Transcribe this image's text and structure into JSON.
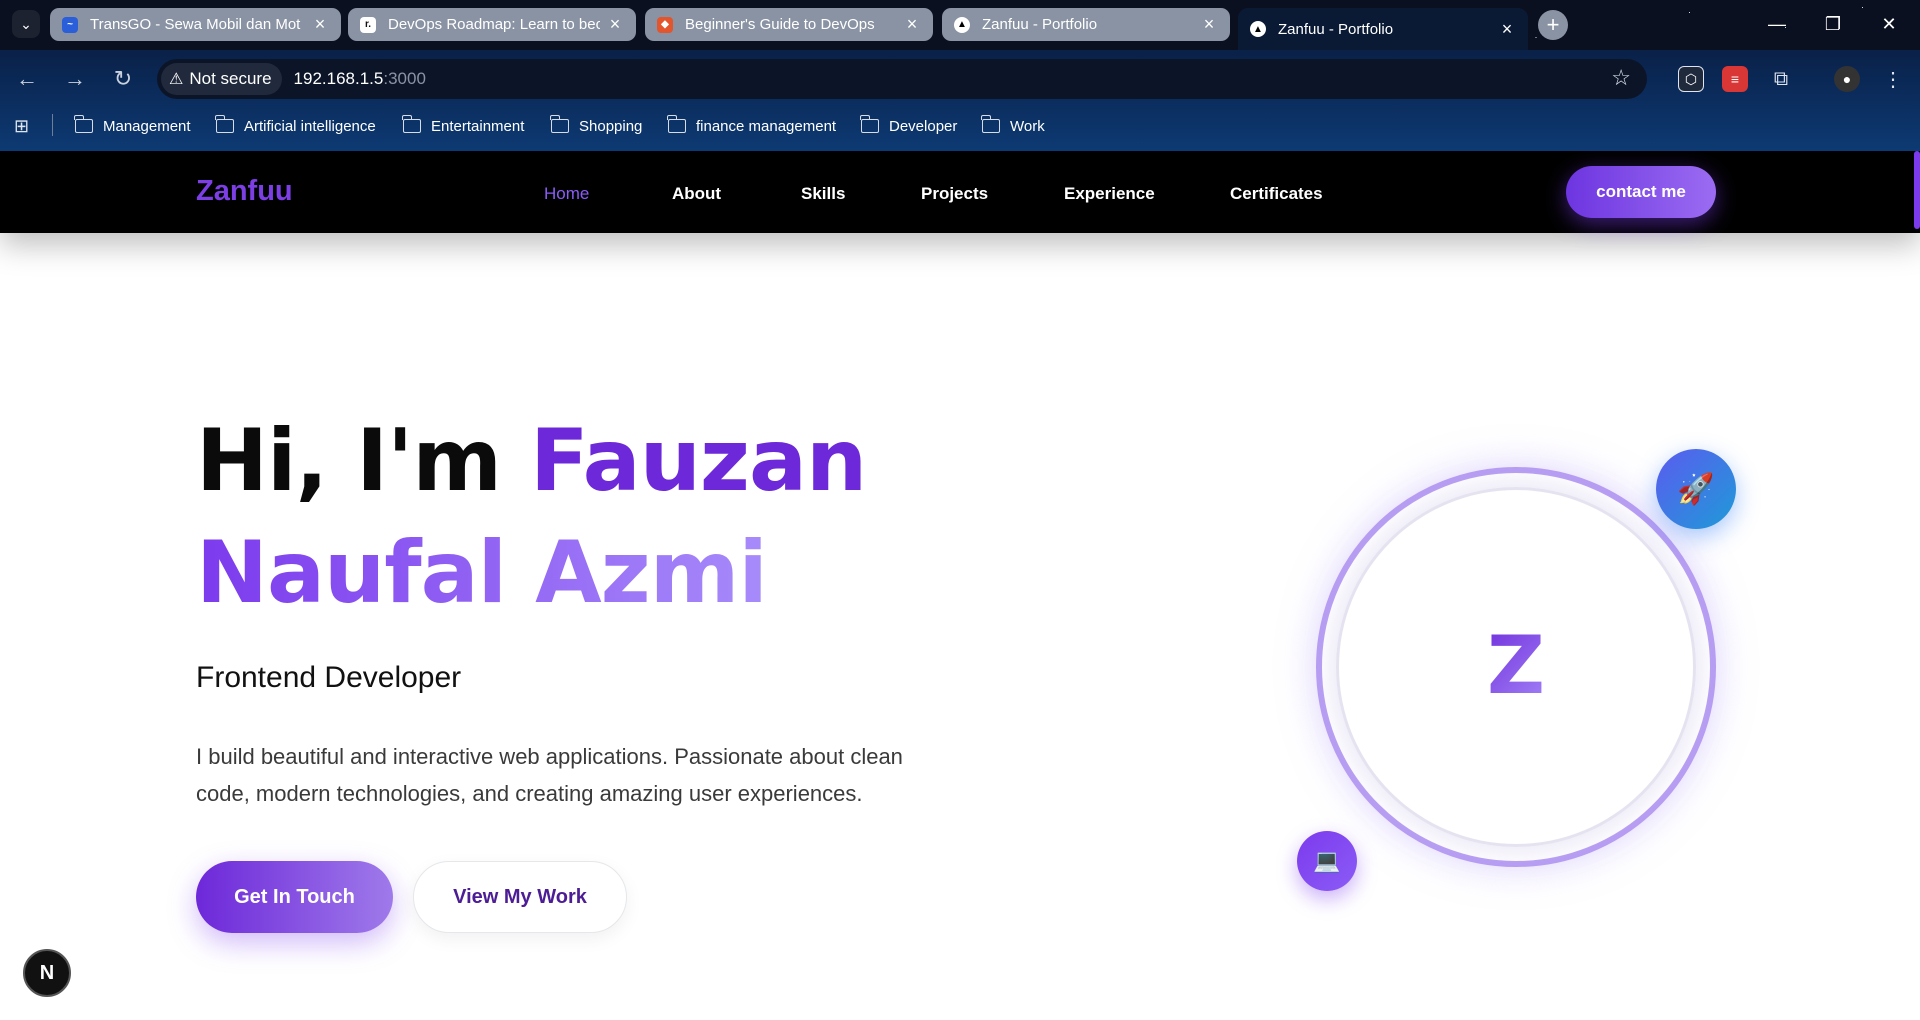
{
  "browser": {
    "tabs": [
      {
        "label": "TransGO - Sewa Mobil dan Mot",
        "favicon": "transgo-icon",
        "active": false
      },
      {
        "label": "DevOps Roadmap: Learn to bec",
        "favicon": "roadmap-icon",
        "active": false
      },
      {
        "label": "Beginner's Guide to DevOps",
        "favicon": "gitlab-icon",
        "active": false
      },
      {
        "label": "Zanfuu - Portfolio",
        "favicon": "vercel-icon",
        "active": false
      },
      {
        "label": "Zanfuu - Portfolio",
        "favicon": "vercel-icon",
        "active": true
      }
    ],
    "security_label": "Not secure",
    "url_host": "192.168.1.5",
    "url_port": ":3000",
    "bookmarks": [
      "Management",
      "Artificial intelligence",
      "Entertainment",
      "Shopping",
      "finance management",
      "Developer",
      "Work"
    ]
  },
  "site": {
    "logo": "Zanfuu",
    "nav": [
      "Home",
      "About",
      "Skills",
      "Projects",
      "Experience",
      "Certificates"
    ],
    "active_nav": "Home",
    "contact_label": "contact me"
  },
  "hero": {
    "greeting": "Hi, I'm",
    "first_name": "Fauzan",
    "rest_name": "Naufal Azmi",
    "role": "Frontend Developer",
    "description": "I build beautiful and interactive web applications. Passionate about clean code, modern technologies, and creating amazing user experiences.",
    "primary_cta": "Get In Touch",
    "secondary_cta": "View My Work",
    "avatar_letter": "Z"
  },
  "dev_badge": "N",
  "colors": {
    "accent": "#7c3aed",
    "accent_light": "#a78bfa",
    "nav_bg": "#000000"
  }
}
